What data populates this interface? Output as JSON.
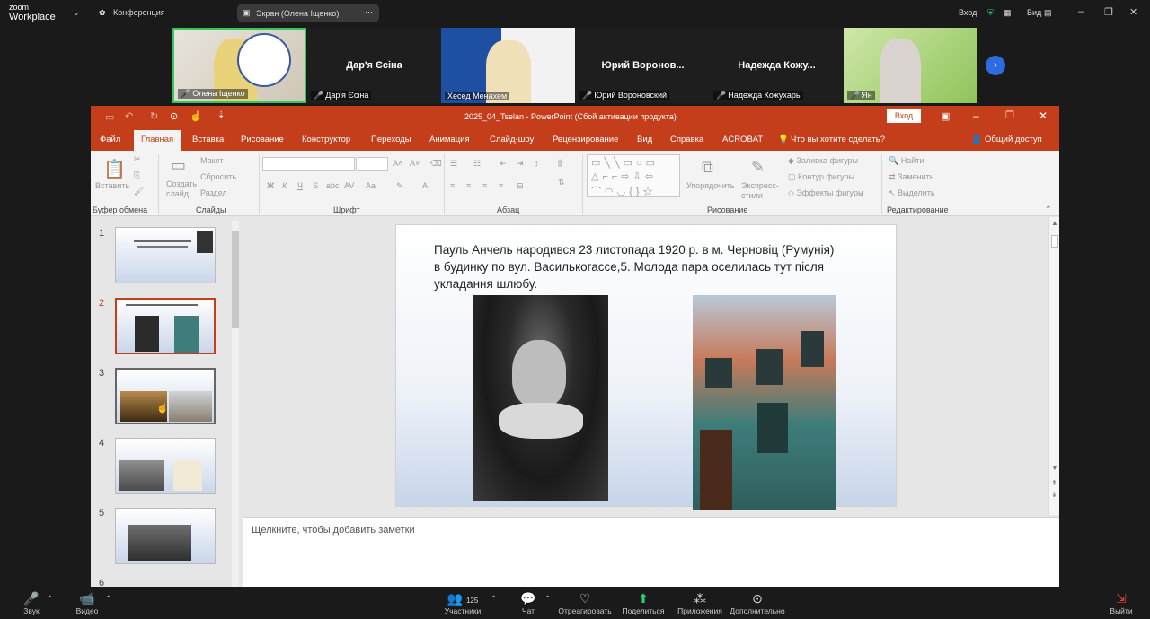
{
  "zoom": {
    "brand_top": "zoom",
    "brand_bottom": "Workplace",
    "meeting_label": "Конференция",
    "share_label": "Экран (Олена Іщенко)",
    "signin": "Вход",
    "view": "Вид",
    "participants": [
      {
        "label": "Олена Іщенко",
        "name_center": ""
      },
      {
        "label": "Дар'я Єсіна",
        "name_center": "Дар'я Єсіна"
      },
      {
        "label": "Хесед Менахем",
        "name_center": ""
      },
      {
        "label": "Юрий Вороновский",
        "name_center": "Юрий Воронов..."
      },
      {
        "label": "Надежда Кожухарь",
        "name_center": "Надежда Кожу..."
      },
      {
        "label": "Ян",
        "name_center": ""
      }
    ],
    "toolbar": {
      "audio": "Звук",
      "video": "Видео",
      "participants": "Участники",
      "participants_count": "125",
      "chat": "Чат",
      "react": "Отреагировать",
      "share": "Поделиться",
      "apps": "Приложения",
      "more": "Дополнительно",
      "leave": "Выйти"
    }
  },
  "ppt": {
    "title": "2025_04_Tselan - PowerPoint (Сбой активации продукта)",
    "signin": "Вход",
    "tabs": [
      "Файл",
      "Главная",
      "Вставка",
      "Рисование",
      "Конструктор",
      "Переходы",
      "Анимация",
      "Слайд-шоу",
      "Рецензирование",
      "Вид",
      "Справка",
      "ACROBAT"
    ],
    "tell_me": "Что вы хотите сделать?",
    "share": "Общий доступ",
    "ribbon": {
      "paste": "Вставить",
      "clipboard": "Буфер обмена",
      "new_slide": "Создать слайд",
      "layout": "Макет",
      "reset": "Сбросить",
      "section": "Раздел",
      "slides": "Слайды",
      "font": "Шрифт",
      "paragraph": "Абзац",
      "arrange": "Упорядочить",
      "quick_styles": "Экспресс-стили",
      "shape_fill": "Заливка фигуры",
      "shape_outline": "Контур фигуры",
      "shape_effects": "Эффекты фигуры",
      "drawing": "Рисование",
      "find": "Найти",
      "replace": "Заменить",
      "select": "Выделить",
      "editing": "Редактирование"
    },
    "slide_numbers": [
      "1",
      "2",
      "3",
      "4",
      "5",
      "6"
    ],
    "slide_text": "Пауль Анчель народився 23 листопада 1920 р. в м. Черновіц (Румунія) в будинку по вул. Василькогассе,5. Молода пара оселилась тут після укладання шлюбу.",
    "notes_placeholder": "Щелкните, чтобы добавить заметки"
  }
}
